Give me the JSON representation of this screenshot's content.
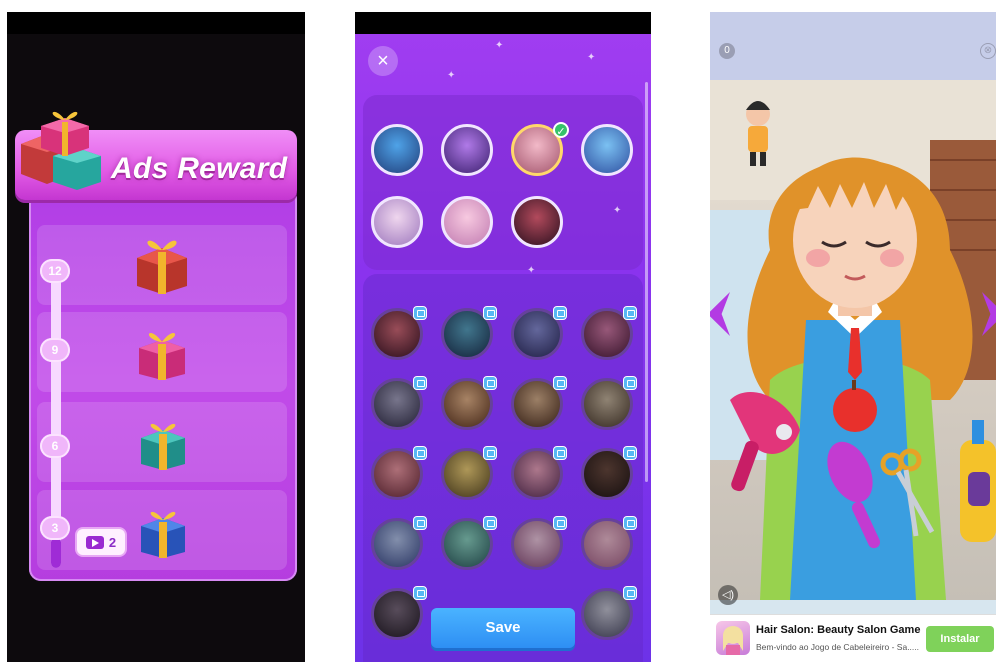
{
  "screen1": {
    "header_title": "Ads Reward",
    "milestones": [
      {
        "label": "12"
      },
      {
        "label": "9"
      },
      {
        "label": "6"
      },
      {
        "label": "3"
      }
    ],
    "ads_watched_badge": "2",
    "gift_colors": [
      "#c63a2f",
      "#d8337a",
      "#2ba6a0",
      "#2f69d9"
    ]
  },
  "screen2": {
    "close_icon": "×",
    "selected_avatar_index": 2,
    "check_icon": "✓",
    "save_label": "Save"
  },
  "screen3": {
    "counter": "0",
    "close_icon": "⊗",
    "sound_icon": "◁)",
    "ad_title": "Hair Salon: Beauty Salon Game",
    "ad_subtitle": "Bem-vindo ao Jogo de Cabeleireiro - Sa.....",
    "install_label": "Instalar"
  }
}
